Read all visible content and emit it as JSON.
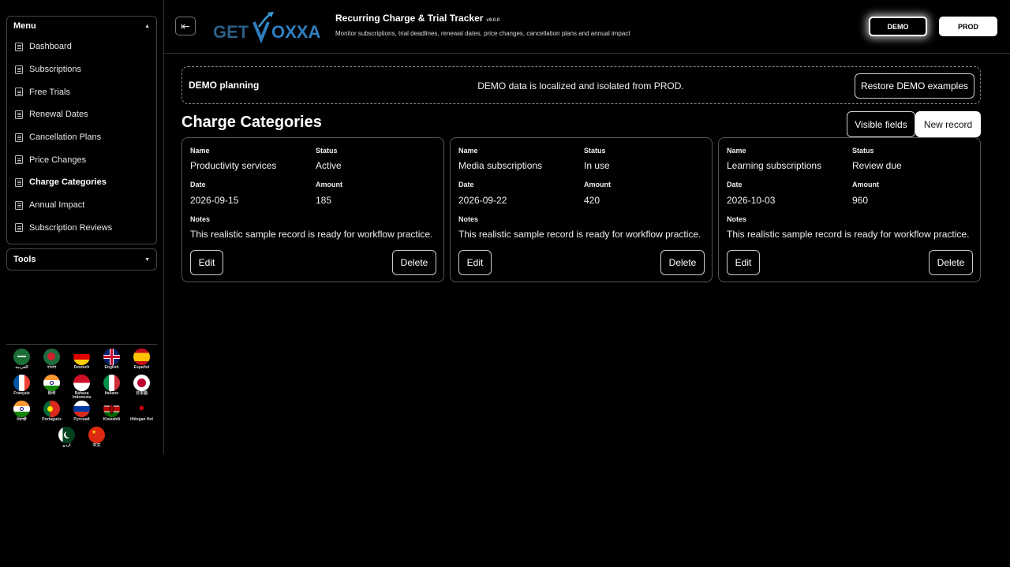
{
  "sidebar": {
    "menu_title": "Menu",
    "menu_items": [
      {
        "label": "Dashboard",
        "active": false
      },
      {
        "label": "Subscriptions",
        "active": false
      },
      {
        "label": "Free Trials",
        "active": false
      },
      {
        "label": "Renewal Dates",
        "active": false
      },
      {
        "label": "Cancellation Plans",
        "active": false
      },
      {
        "label": "Price Changes",
        "active": false
      },
      {
        "label": "Charge Categories",
        "active": true
      },
      {
        "label": "Annual Impact",
        "active": false
      },
      {
        "label": "Subscription Reviews",
        "active": false
      }
    ],
    "tools_title": "Tools",
    "languages": [
      {
        "name": "العربية",
        "flag": "sa"
      },
      {
        "name": "বাংলা",
        "flag": "bd"
      },
      {
        "name": "Deutsch",
        "flag": "de"
      },
      {
        "name": "English",
        "flag": "gb"
      },
      {
        "name": "Español",
        "flag": "es"
      },
      {
        "name": "Français",
        "flag": "fr"
      },
      {
        "name": "हिन्दी",
        "flag": "in"
      },
      {
        "name": "Bahasa Indonesia",
        "flag": "id"
      },
      {
        "name": "Italiano",
        "flag": "it"
      },
      {
        "name": "日本語",
        "flag": "jp"
      },
      {
        "name": "ਪੰਜਾਬੀ",
        "flag": "in"
      },
      {
        "name": "Português",
        "flag": "pt"
      },
      {
        "name": "Русский",
        "flag": "ru"
      },
      {
        "name": "Kiswahili",
        "flag": "ke"
      },
      {
        "name": "tlhIngan Hol",
        "flag": "kl"
      },
      {
        "name": "اردو",
        "flag": "pk"
      },
      {
        "name": "中文",
        "flag": "cn"
      }
    ]
  },
  "header": {
    "logo_text_left": "GET",
    "logo_text_right": "OXXA",
    "title": "Recurring Charge & Trial Tracker",
    "version": "v9.0.0",
    "subtitle": "Monitor subscriptions, trial deadlines, renewal dates, price changes, cancellation plans and annual impact",
    "demo_label": "DEMO",
    "prod_label": "PROD"
  },
  "banner": {
    "title": "DEMO planning",
    "message": "DEMO data is localized and isolated from PROD.",
    "restore_label": "Restore DEMO examples"
  },
  "main": {
    "title": "Charge Categories",
    "visible_fields_label": "Visible fields",
    "new_record_label": "New record",
    "field_labels": {
      "name": "Name",
      "status": "Status",
      "date": "Date",
      "amount": "Amount",
      "notes": "Notes"
    },
    "edit_label": "Edit",
    "delete_label": "Delete",
    "records": [
      {
        "name": "Productivity services",
        "status": "Active",
        "date": "2026-09-15",
        "amount": "185",
        "notes": "This realistic sample record is ready for workflow practice."
      },
      {
        "name": "Media subscriptions",
        "status": "In use",
        "date": "2026-09-22",
        "amount": "420",
        "notes": "This realistic sample record is ready for workflow practice."
      },
      {
        "name": "Learning subscriptions",
        "status": "Review due",
        "date": "2026-10-03",
        "amount": "960",
        "notes": "This realistic sample record is ready for workflow practice."
      }
    ]
  },
  "colors": {
    "background": "#000000",
    "accent": "#2f7fc1"
  }
}
